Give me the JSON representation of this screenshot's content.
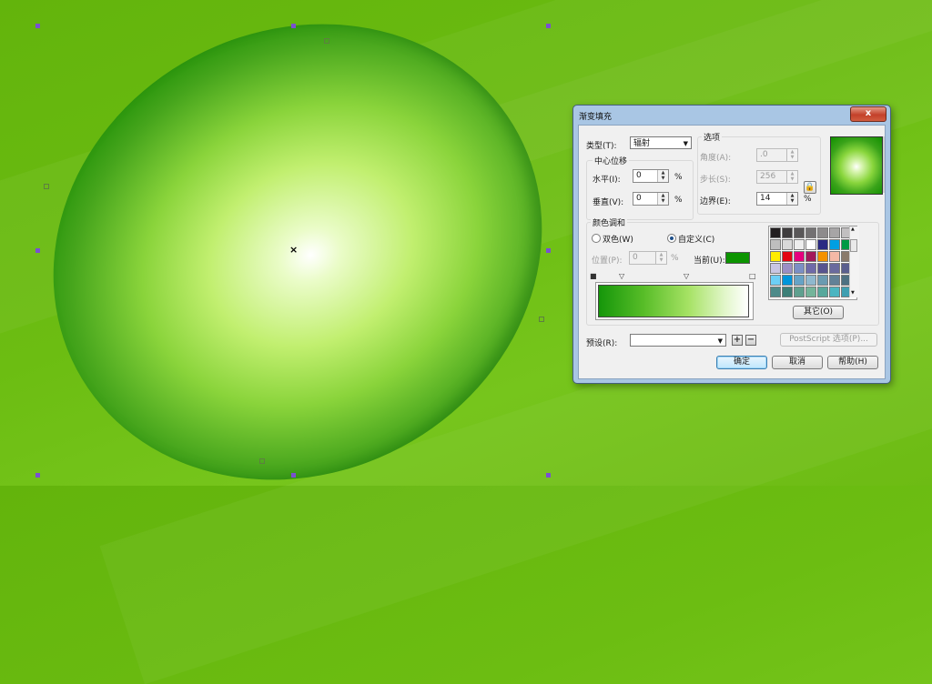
{
  "canvas": {
    "background_color": "#6cbd12",
    "fill_colors": {
      "center": "#ffffff",
      "edge": "#138a00"
    }
  },
  "dialog": {
    "title": "渐变填充",
    "close_glyph": "x",
    "type_label": "类型(T):",
    "type_value": "辐射",
    "center_offset": {
      "group_label": "中心位移",
      "horizontal_label": "水平(I):",
      "horizontal_value": "0",
      "vertical_label": "垂直(V):",
      "vertical_value": "0",
      "unit": "%"
    },
    "options": {
      "group_label": "选项",
      "angle_label": "角度(A):",
      "angle_value": ".0",
      "steps_label": "步长(S):",
      "steps_value": "256",
      "edge_pad_label": "边界(E):",
      "edge_pad_value": "14",
      "unit": "%"
    },
    "color_blend": {
      "group_label": "颜色调和",
      "two_color_label": "双色(W)",
      "custom_label": "自定义(C)",
      "custom_selected": true,
      "position_label": "位置(P):",
      "position_value": "0",
      "position_unit": "%",
      "current_label": "当前(U):",
      "current_color": "#0c9400",
      "others_button": "其它(O)",
      "palette": [
        "#231f20",
        "#3f3d3e",
        "#595758",
        "#737172",
        "#8d8b8c",
        "#a7a5a6",
        "#c1bfc0",
        "#bebebe",
        "#d9d9d9",
        "#ededed",
        "#ffffff",
        "#2b2a83",
        "#009fe3",
        "#009a44",
        "#ffec00",
        "#e30613",
        "#e6007e",
        "#a3195b",
        "#f39200",
        "#f5b9a6",
        "#8a7a6b",
        "#c9c6e2",
        "#9b8fc4",
        "#7b8fc5",
        "#6f6aa8",
        "#58548f",
        "#6a6a9e",
        "#5a5f8e",
        "#6dcff6",
        "#0095da",
        "#66a3c6",
        "#8fb8ce",
        "#6b9bb1",
        "#628197",
        "#4d7081",
        "#4e8b8a",
        "#3d7f77",
        "#5fa08f",
        "#74b49a",
        "#58a89c",
        "#4bb5c1",
        "#3f9fb1"
      ]
    },
    "preset_label": "预设(R):",
    "preset_value": "",
    "postscript_button": "PostScript 选项(P)...",
    "ok_button": "确定",
    "cancel_button": "取消",
    "help_button": "帮助(H)"
  }
}
